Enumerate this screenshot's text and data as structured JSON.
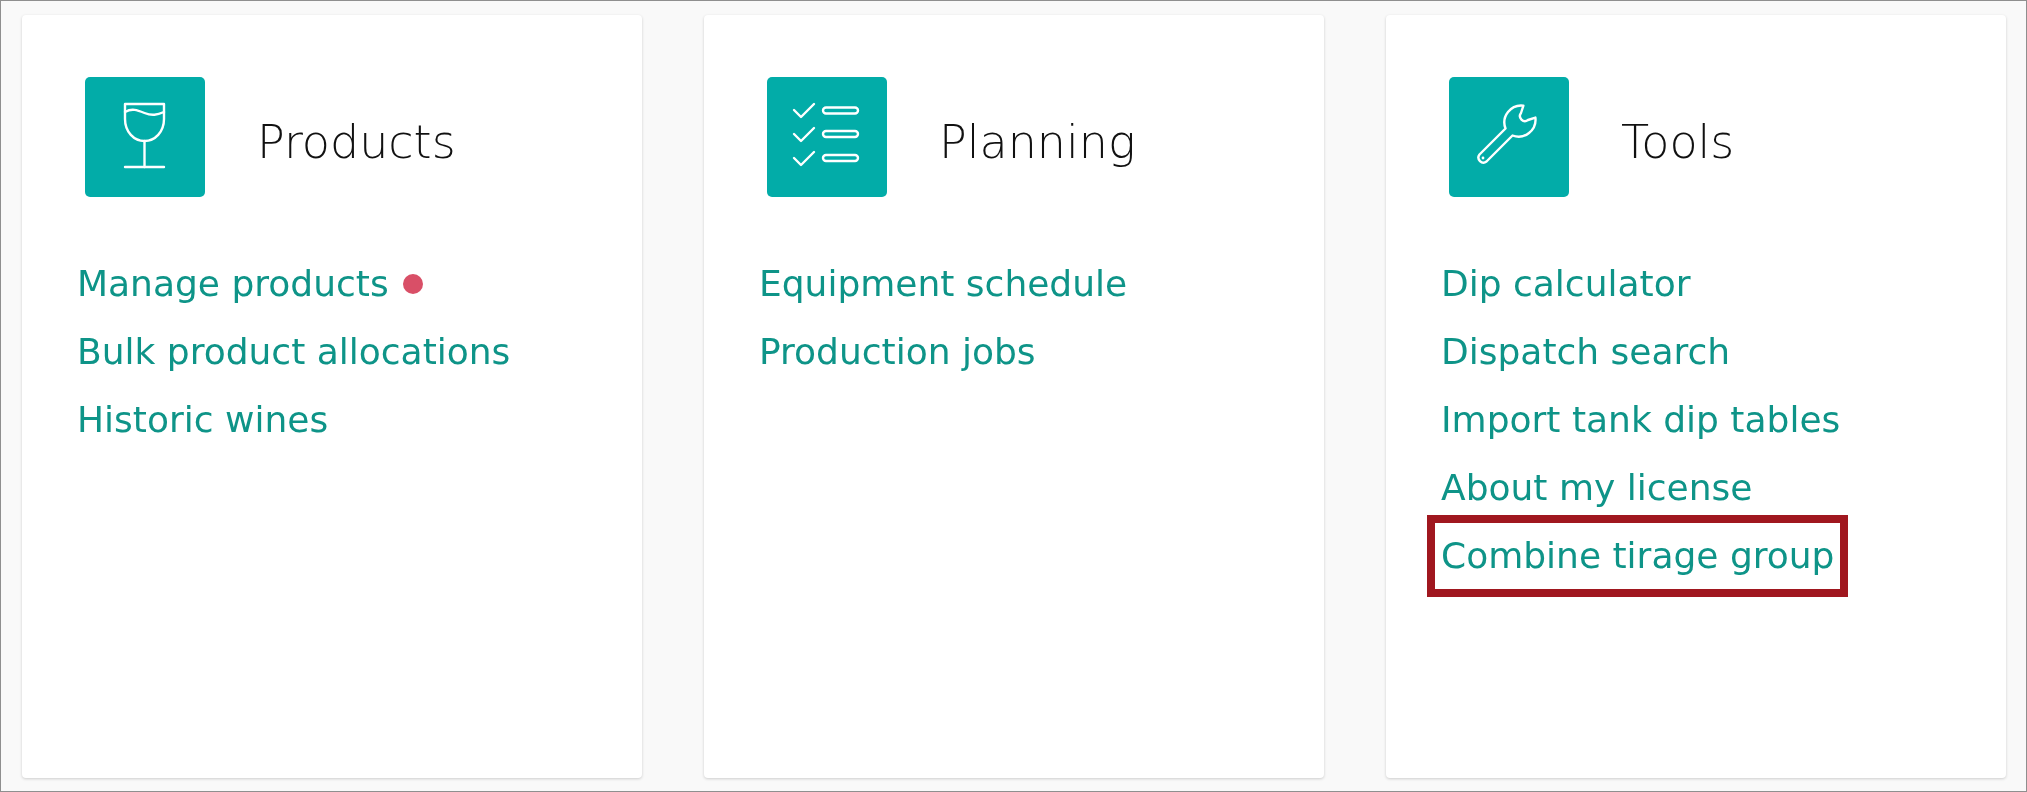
{
  "cards": [
    {
      "title": "Products",
      "links": [
        {
          "label": "Manage products",
          "dot": true,
          "highlighted": false
        },
        {
          "label": "Bulk product allocations",
          "dot": false,
          "highlighted": false
        },
        {
          "label": "Historic wines",
          "dot": false,
          "highlighted": false
        }
      ]
    },
    {
      "title": "Planning",
      "links": [
        {
          "label": "Equipment schedule",
          "dot": false,
          "highlighted": false
        },
        {
          "label": "Production jobs",
          "dot": false,
          "highlighted": false
        }
      ]
    },
    {
      "title": "Tools",
      "links": [
        {
          "label": "Dip calculator",
          "dot": false,
          "highlighted": false
        },
        {
          "label": "Dispatch search",
          "dot": false,
          "highlighted": false
        },
        {
          "label": "Import tank dip tables",
          "dot": false,
          "highlighted": false
        },
        {
          "label": "About my license",
          "dot": false,
          "highlighted": false
        },
        {
          "label": "Combine tirage group",
          "dot": false,
          "highlighted": true
        }
      ]
    }
  ]
}
